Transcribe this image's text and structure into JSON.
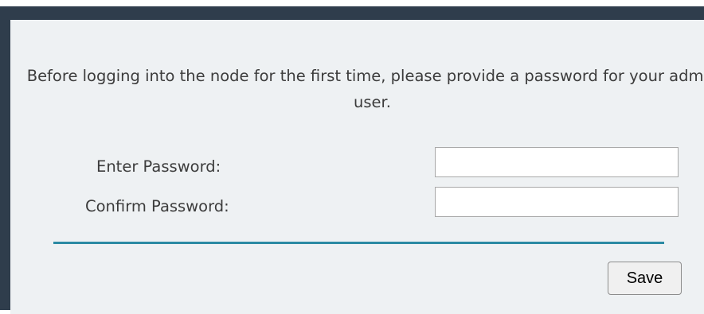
{
  "dialog": {
    "message": "Before logging into the node for the first time, please provide a password for your admin user.",
    "enter_password_label": "Enter Password:",
    "enter_password_value": "",
    "confirm_password_label": "Confirm Password:",
    "confirm_password_value": "",
    "save_label": "Save"
  },
  "colors": {
    "frame": "#2f3d4c",
    "dialog_background": "#eef1f3",
    "divider": "#2b8aa3"
  }
}
